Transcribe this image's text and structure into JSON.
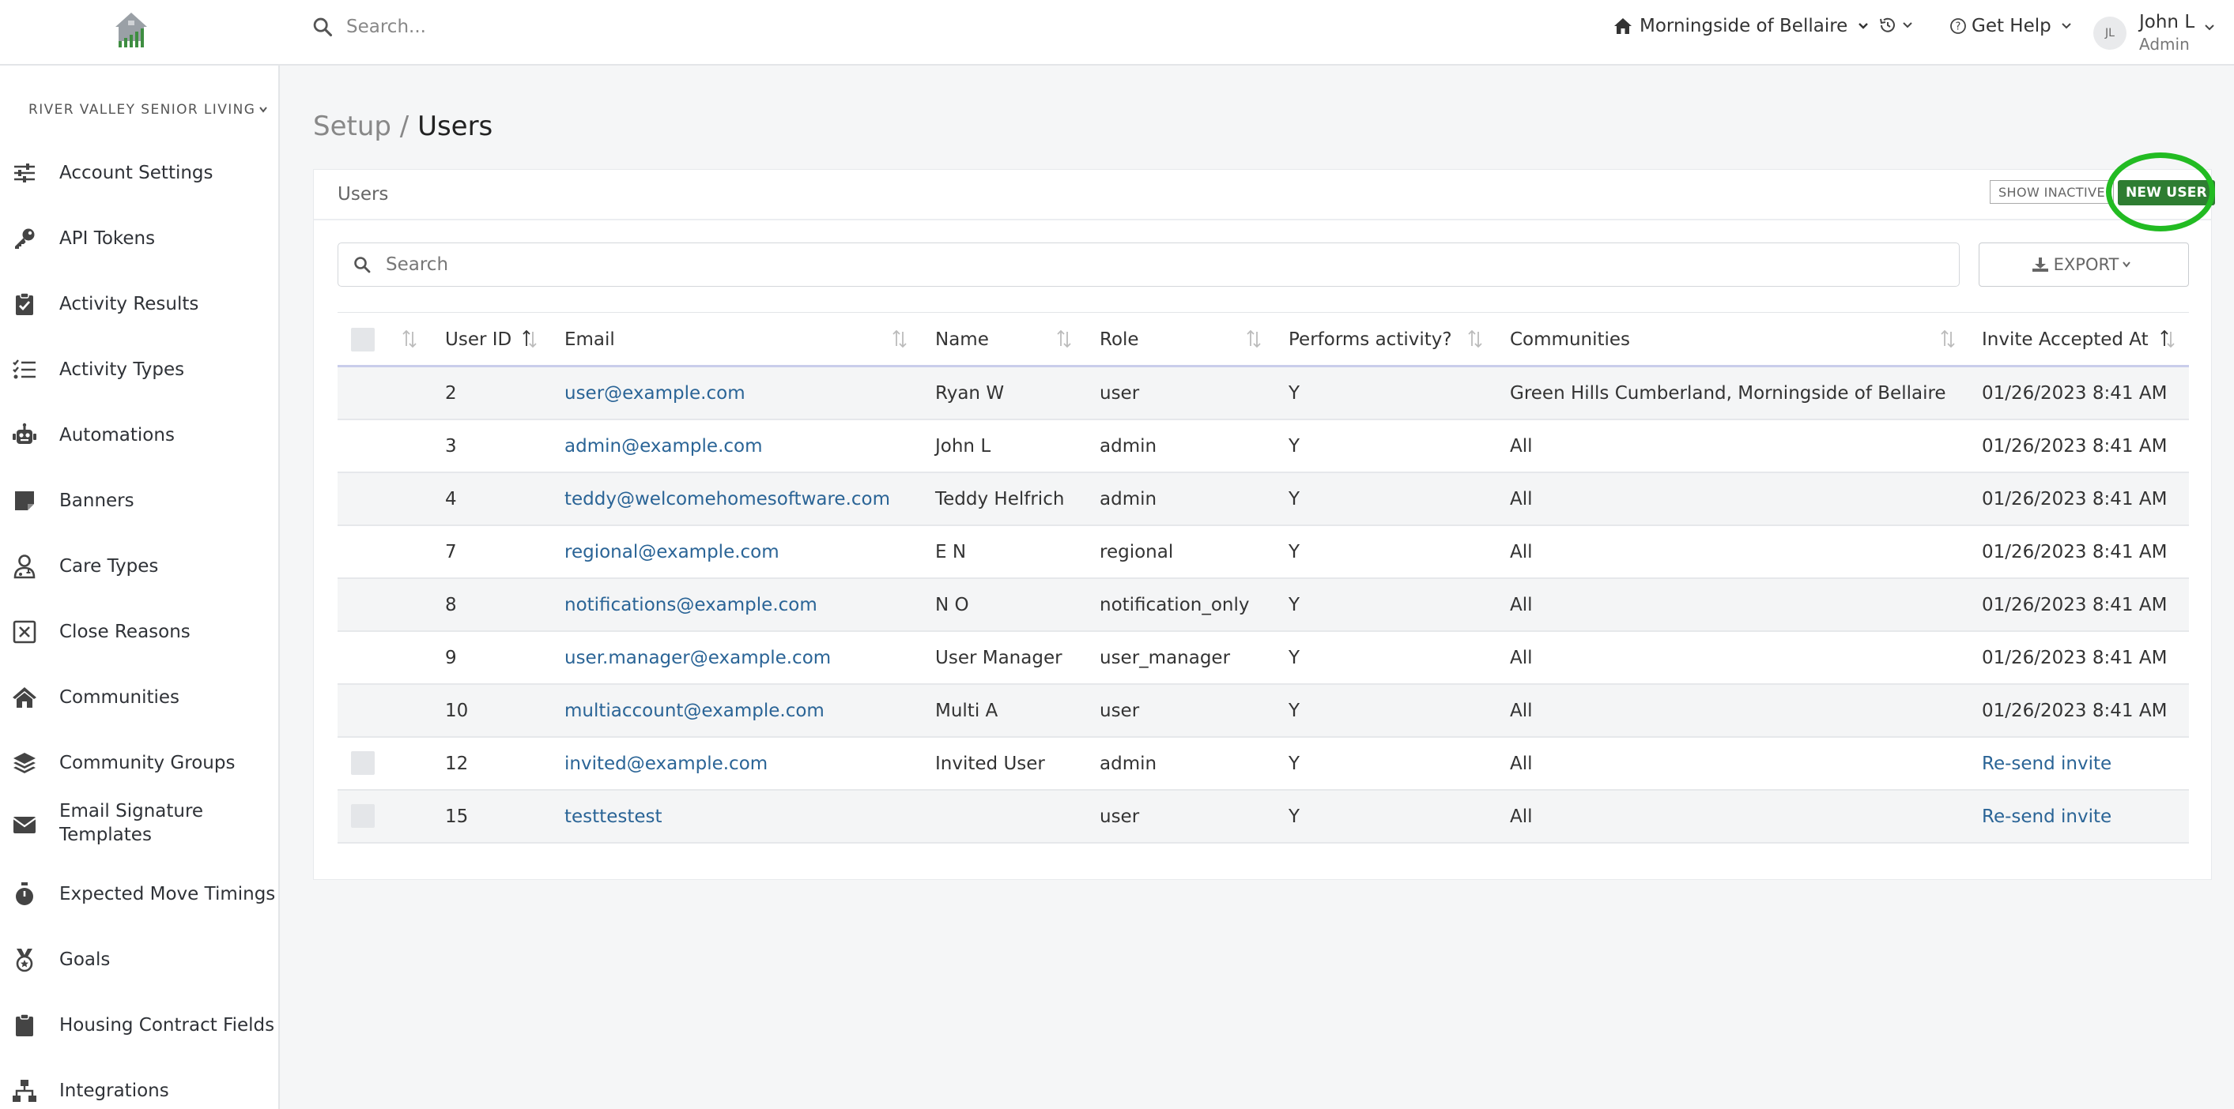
{
  "header": {
    "search_placeholder": "Search...",
    "community": "Morningside of Bellaire",
    "help": "Get Help",
    "user_initials": "JL",
    "user_name": "John L",
    "user_role": "Admin"
  },
  "sidebar": {
    "org": "RIVER VALLEY SENIOR LIVING",
    "items": [
      {
        "label": "Account Settings",
        "icon": "sliders-icon"
      },
      {
        "label": "API Tokens",
        "icon": "key-icon"
      },
      {
        "label": "Activity Results",
        "icon": "clipboard-check-icon"
      },
      {
        "label": "Activity Types",
        "icon": "list-check-icon"
      },
      {
        "label": "Automations",
        "icon": "robot-icon"
      },
      {
        "label": "Banners",
        "icon": "sticky-note-icon"
      },
      {
        "label": "Care Types",
        "icon": "user-doctor-icon"
      },
      {
        "label": "Close Reasons",
        "icon": "square-x-icon"
      },
      {
        "label": "Communities",
        "icon": "house-icon"
      },
      {
        "label": "Community Groups",
        "icon": "layers-icon"
      },
      {
        "label": "Email Signature Templates",
        "icon": "envelope-icon"
      },
      {
        "label": "Expected Move Timings",
        "icon": "stopwatch-icon"
      },
      {
        "label": "Goals",
        "icon": "medal-icon"
      },
      {
        "label": "Housing Contract Fields",
        "icon": "clipboard-icon"
      },
      {
        "label": "Integrations",
        "icon": "network-icon"
      }
    ]
  },
  "breadcrumb": {
    "parent": "Setup",
    "separator": "/",
    "current": "Users"
  },
  "card": {
    "title": "Users",
    "show_inactive": "SHOW INACTIVE",
    "new_user": "NEW USER",
    "search_placeholder": "Search",
    "export": "EXPORT"
  },
  "table": {
    "columns": [
      "User ID",
      "Email",
      "Name",
      "Role",
      "Performs activity?",
      "Communities",
      "Invite Accepted At"
    ],
    "rows": [
      {
        "id": "2",
        "email": "user@example.com",
        "name": "Ryan W",
        "role": "user",
        "performs": "Y",
        "communities": "Green Hills Cumberland, Morningside of Bellaire",
        "accepted": "01/26/2023 8:41 AM"
      },
      {
        "id": "3",
        "email": "admin@example.com",
        "name": "John L",
        "role": "admin",
        "performs": "Y",
        "communities": "All",
        "accepted": "01/26/2023 8:41 AM"
      },
      {
        "id": "4",
        "email": "teddy@welcomehomesoftware.com",
        "name": "Teddy Helfrich",
        "role": "admin",
        "performs": "Y",
        "communities": "All",
        "accepted": "01/26/2023 8:41 AM"
      },
      {
        "id": "7",
        "email": "regional@example.com",
        "name": "E N",
        "role": "regional",
        "performs": "Y",
        "communities": "All",
        "accepted": "01/26/2023 8:41 AM"
      },
      {
        "id": "8",
        "email": "notifications@example.com",
        "name": "N O",
        "role": "notification_only",
        "performs": "Y",
        "communities": "All",
        "accepted": "01/26/2023 8:41 AM"
      },
      {
        "id": "9",
        "email": "user.manager@example.com",
        "name": "User Manager",
        "role": "user_manager",
        "performs": "Y",
        "communities": "All",
        "accepted": "01/26/2023 8:41 AM"
      },
      {
        "id": "10",
        "email": "multiaccount@example.com",
        "name": "Multi A",
        "role": "user",
        "performs": "Y",
        "communities": "All",
        "accepted": "01/26/2023 8:41 AM"
      },
      {
        "id": "12",
        "email": "invited@example.com",
        "name": "Invited User",
        "role": "admin",
        "performs": "Y",
        "communities": "All",
        "accepted": "Re-send invite"
      },
      {
        "id": "15",
        "email": "testtestest",
        "name": "",
        "role": "user",
        "performs": "Y",
        "communities": "All",
        "accepted": "Re-send invite"
      }
    ]
  },
  "colors": {
    "accent": "#2e7d32",
    "link": "#2a6496",
    "highlight": "#22bb22"
  }
}
